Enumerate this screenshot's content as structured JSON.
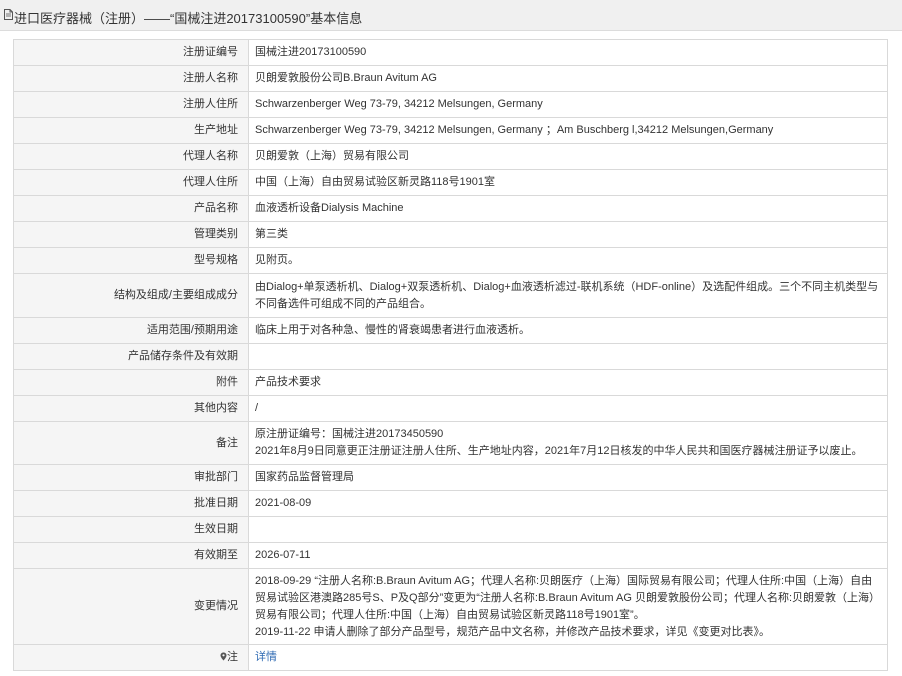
{
  "header": {
    "title": "进口医疗器械（注册）——“国械注进20173100590”基本信息"
  },
  "rows": [
    {
      "label": "注册证编号",
      "value": "国械注进20173100590"
    },
    {
      "label": "注册人名称",
      "value": "贝朗爱敦股份公司B.Braun Avitum AG"
    },
    {
      "label": "注册人住所",
      "value": "Schwarzenberger Weg 73-79, 34212 Melsungen, Germany"
    },
    {
      "label": "生产地址",
      "value": "Schwarzenberger Weg 73-79, 34212 Melsungen, Germany ；Am Buschberg l,34212 Melsungen,Germany"
    },
    {
      "label": "代理人名称",
      "value": "贝朗爱敦（上海）贸易有限公司"
    },
    {
      "label": "代理人住所",
      "value": "中国（上海）自由贸易试验区新灵路118号1901室"
    },
    {
      "label": "产品名称",
      "value": "血液透析设备Dialysis Machine"
    },
    {
      "label": "管理类别",
      "value": "第三类"
    },
    {
      "label": "型号规格",
      "value": "见附页。"
    },
    {
      "label": "结构及组成/主要组成成分",
      "value": "由Dialog+单泵透析机、Dialog+双泵透析机、Dialog+血液透析滤过-联机系统（HDF-online）及选配件组成。三个不同主机类型与不同备选件可组成不同的产品组合。"
    },
    {
      "label": "适用范围/预期用途",
      "value": "临床上用于对各种急、慢性的肾衰竭患者进行血液透析。"
    },
    {
      "label": "产品储存条件及有效期",
      "value": ""
    },
    {
      "label": "附件",
      "value": "产品技术要求"
    },
    {
      "label": "其他内容",
      "value": "/"
    },
    {
      "label": "备注",
      "lines": [
        "原注册证编号：国械注进20173450590",
        "2021年8月9日同意更正注册证注册人住所、生产地址内容，2021年7月12日核发的中华人民共和国医疗器械注册证予以废止。"
      ]
    },
    {
      "label": "审批部门",
      "value": "国家药品监督管理局"
    },
    {
      "label": "批准日期",
      "value": "2021-08-09"
    },
    {
      "label": "生效日期",
      "value": ""
    },
    {
      "label": "有效期至",
      "value": "2026-07-11"
    },
    {
      "label": "变更情况",
      "lines": [
        "2018-09-29 “注册人名称:B.Braun Avitum AG；代理人名称:贝朗医疗（上海）国际贸易有限公司；代理人住所:中国（上海）自由贸易试验区港澳路285号S、P及Q部分”变更为“注册人名称:B.Braun Avitum AG 贝朗爱敦股份公司；代理人名称:贝朗爱敦（上海）贸易有限公司；代理人住所:中国（上海）自由贸易试验区新灵路118号1901室”。",
        "2019-11-22 申请人删除了部分产品型号，规范产品中文名称，并修改产品技术要求，详见《变更对比表》。"
      ]
    },
    {
      "label": "注",
      "value": "详情",
      "link": true
    }
  ],
  "icons": {
    "header_icon": "document-icon",
    "note_icon": "map-pin-icon"
  }
}
